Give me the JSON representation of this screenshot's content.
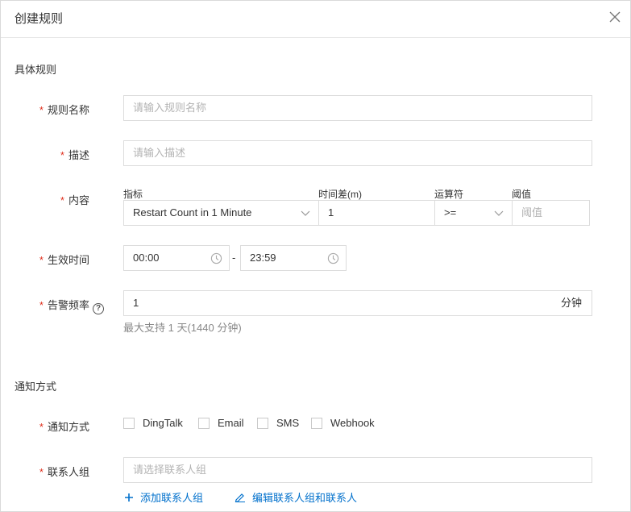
{
  "dialog": {
    "title": "创建规则"
  },
  "sections": {
    "rule": "具体规则",
    "notify": "通知方式"
  },
  "form": {
    "name": {
      "label": "规则名称",
      "placeholder": "请输入规则名称"
    },
    "desc": {
      "label": "描述",
      "placeholder": "请输入描述"
    },
    "content": {
      "label": "内容",
      "metric_label": "指标",
      "metric_value": "Restart Count in 1 Minute",
      "timediff_label": "时间差(m)",
      "timediff_value": "1",
      "operator_label": "运算符",
      "operator_value": ">=",
      "threshold_label": "阈值",
      "threshold_placeholder": "阈值"
    },
    "active_time": {
      "label": "生效时间",
      "start": "00:00",
      "separator": "-",
      "end": "23:59"
    },
    "frequency": {
      "label": "告警频率",
      "value": "1",
      "unit": "分钟",
      "hint": "最大支持 1 天(1440 分钟)"
    },
    "notify_method": {
      "label": "通知方式",
      "options": [
        "DingTalk",
        "Email",
        "SMS",
        "Webhook"
      ]
    },
    "contact_group": {
      "label": "联系人组",
      "placeholder": "请选择联系人组",
      "add_link": "添加联系人组",
      "edit_link": "编辑联系人组和联系人"
    }
  },
  "colors": {
    "required": "#e0301e",
    "link": "#0070cc"
  },
  "icons": {
    "close": "close-icon",
    "chevron": "chevron-down-icon",
    "clock": "clock-icon",
    "help": "help-circle-icon",
    "plus": "plus-icon",
    "edit": "edit-icon"
  }
}
